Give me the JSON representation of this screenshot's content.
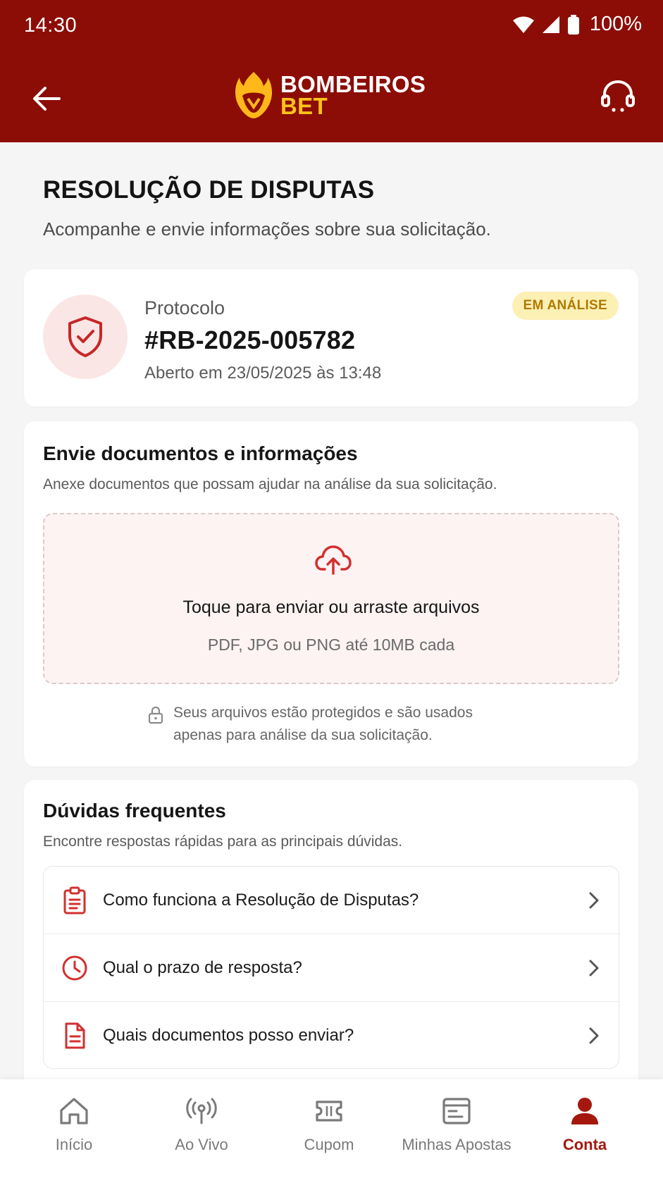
{
  "status_bar": {
    "time": "14:30",
    "battery": "100%"
  },
  "app_bar": {
    "logo_line1": "BOMBEIROS",
    "logo_line2": "BET"
  },
  "page": {
    "title": "RESOLUÇÃO DE DISPUTAS",
    "subtitle": "Acompanhe e envie informações sobre sua solicitação."
  },
  "protocol": {
    "label": "Protocolo",
    "number": "#RB-2025-005782",
    "opened": "Aberto em 23/05/2025 às 13:48",
    "status": "EM ANÁLISE"
  },
  "upload": {
    "title": "Envie documentos e informações",
    "description": "Anexe documentos que possam ajudar na análise da sua solicitação.",
    "dropzone_title": "Toque para enviar ou arraste arquivos",
    "dropzone_hint": "PDF, JPG ou PNG até 10MB cada",
    "privacy_note": "Seus arquivos estão protegidos e são usados apenas para análise da sua solicitação."
  },
  "faq": {
    "title": "Dúvidas frequentes",
    "description": "Encontre respostas rápidas para as principais dúvidas.",
    "items": [
      {
        "label": "Como funciona a Resolução de Disputas?",
        "icon": "clipboard-icon"
      },
      {
        "label": "Qual o prazo de resposta?",
        "icon": "clock-icon"
      },
      {
        "label": "Quais documentos posso enviar?",
        "icon": "document-icon"
      }
    ]
  },
  "bottom_nav": {
    "items": [
      {
        "label": "Início",
        "icon": "home-icon"
      },
      {
        "label": "Ao Vivo",
        "icon": "live-broadcast-icon"
      },
      {
        "label": "Cupom",
        "icon": "ticket-icon"
      },
      {
        "label": "Minhas Apostas",
        "icon": "bets-list-icon"
      },
      {
        "label": "Conta",
        "icon": "user-icon"
      }
    ],
    "active": "Conta"
  },
  "colors": {
    "brand_red": "#8c0d05",
    "brand_yellow": "#ffc21a",
    "accent_red": "#d32f2f",
    "status_bg": "#fdf0b5",
    "status_text": "#b07a00"
  }
}
